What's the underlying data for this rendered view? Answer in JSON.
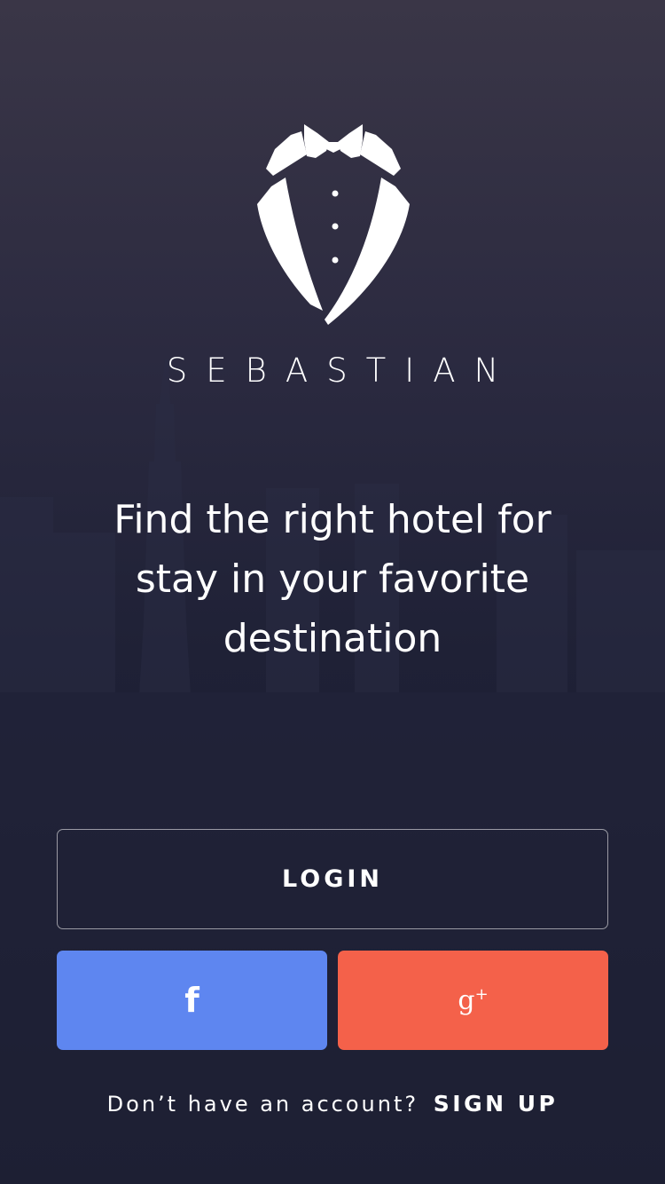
{
  "brand": {
    "name": "SEBASTIAN"
  },
  "tagline": "Find the right hotel for stay in your favorite destination",
  "buttons": {
    "login_label": "LOGIN",
    "facebook_icon": "f",
    "google_icon": "g",
    "google_icon_plus": "+"
  },
  "signup": {
    "prompt": "Don’t have an account?",
    "link_label": "SIGN UP"
  },
  "colors": {
    "background_top": "#3a3647",
    "background_bottom": "#181a2c",
    "facebook": "#5e86f0",
    "google": "#f4614a",
    "text": "#ffffff"
  },
  "icons": {
    "logo": "tuxedo-logo-icon",
    "facebook": "facebook-icon",
    "google": "google-plus-icon"
  }
}
